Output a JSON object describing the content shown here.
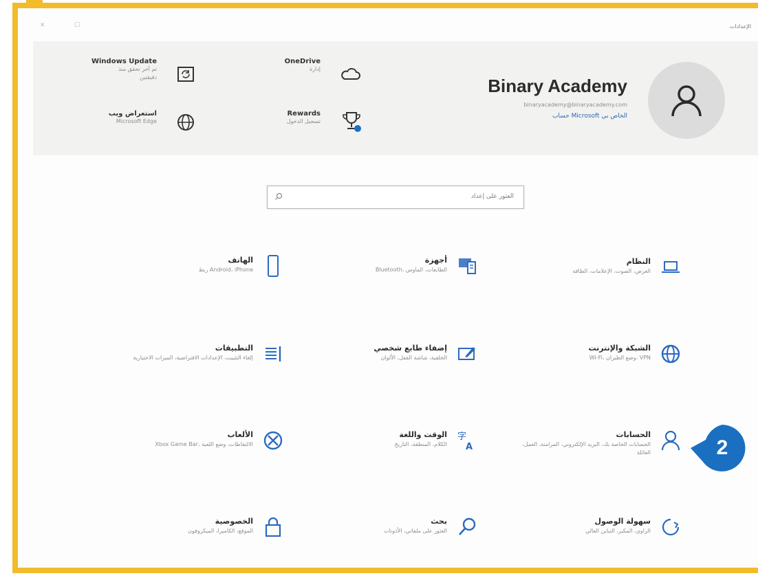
{
  "window": {
    "title": "الإعدادات"
  },
  "header": {
    "account": {
      "name": "Binary Academy",
      "email": "binaryacademy@binaryacademy.com",
      "link": "حساب Microsoft الخاص بي"
    },
    "onedrive": {
      "title": "OneDrive",
      "sub": "إدارة"
    },
    "rewards": {
      "title": "Rewards",
      "sub": "تسجيل الدخول"
    },
    "windows_update": {
      "title": "Windows Update",
      "sub1": "تم آخر تحقق منذ",
      "sub2": "دقيقتين"
    },
    "browsing": {
      "title": "استعراض ويب",
      "sub": "Microsoft Edge"
    }
  },
  "search": {
    "placeholder": "العثور على إعداد"
  },
  "tiles": [
    {
      "title": "النظام",
      "desc": "العرض، الصوت، الإعلامات، الطاقة"
    },
    {
      "title": "أجهزة",
      "desc": "Bluetooth، الطابعات، الماوس"
    },
    {
      "title": "الهاتف",
      "desc": "ربط Android، iPhone"
    },
    {
      "title": "الشبكة والإنترنت",
      "desc": "Wi-Fi، وضع الطيران، VPN"
    },
    {
      "title": "إضفاء طابع شخصي",
      "desc": "الخلفية، شاشة القفل، الألوان"
    },
    {
      "title": "التطبيقات",
      "desc": "إلغاء التثبيت، الإعدادات الافتراضية، الميزات الاختيارية"
    },
    {
      "title": "الحسابات",
      "desc": "الحسابات الخاصة بك، البريد الإلكتروني، المزامنة، العمل، العائلة"
    },
    {
      "title": "الوقت واللغة",
      "desc": "الكلام، المنطقة، التاريخ"
    },
    {
      "title": "الألعاب",
      "desc": "Xbox Game Bar، الالتقاطات، وضع اللعبة"
    },
    {
      "title": "سهولة الوصول",
      "desc": "الراوي، المكبر، التباين العالي"
    },
    {
      "title": "بحث",
      "desc": "العثور على ملفاتي، الأذونات"
    },
    {
      "title": "الخصوصية",
      "desc": "الموقع، الكاميرا، الميكروفون"
    }
  ],
  "callout": {
    "number": "2",
    "color": "#1a6fc1"
  },
  "colors": {
    "accent": "#2a6ac0",
    "frame": "#f2bb2b"
  }
}
